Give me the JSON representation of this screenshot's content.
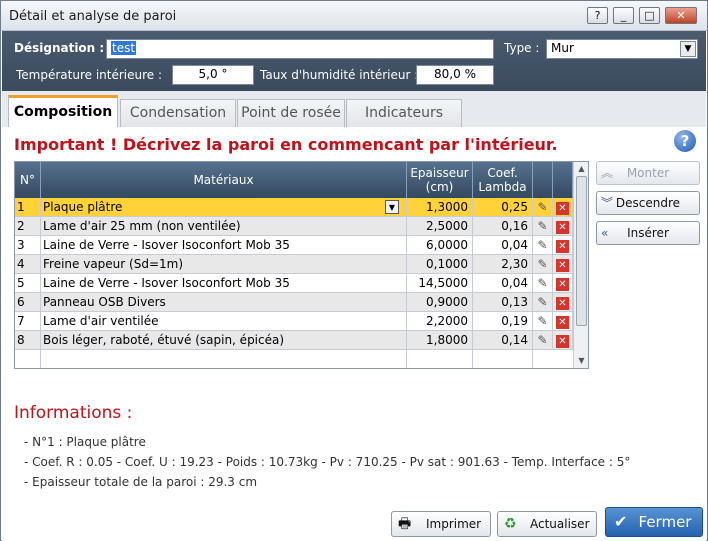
{
  "window": {
    "title": "Détail et analyse de paroi",
    "btn_help": "?",
    "btn_min": "_",
    "btn_max": "□",
    "btn_close": "✕"
  },
  "header": {
    "designation_label": "Désignation :",
    "designation_value": "test",
    "type_label": "Type :",
    "type_value": "Mur",
    "temp_label": "Température intérieure :",
    "temp_value": "5,0 °",
    "humid_label": "Taux d'humidité intérieur :",
    "humid_value": "80,0 %"
  },
  "tabs": [
    "Composition",
    "Condensation",
    "Point de rosée",
    "Indicateurs"
  ],
  "important": "Important ! Décrivez la paroi en commencant par l'intérieur.",
  "grid": {
    "headers": {
      "num": "N°",
      "materiaux": "Matériaux",
      "epaisseur": "Epaisseur (cm)",
      "lambda": "Coef. Lambda"
    },
    "rows": [
      {
        "n": "1",
        "mat": "Plaque plâtre",
        "ep": "1,3000",
        "lam": "0,25"
      },
      {
        "n": "2",
        "mat": "Lame d'air 25 mm (non ventilée)",
        "ep": "2,5000",
        "lam": "0,16"
      },
      {
        "n": "3",
        "mat": "Laine de Verre - Isover Isoconfort Mob 35",
        "ep": "6,0000",
        "lam": "0,04"
      },
      {
        "n": "4",
        "mat": "Freine vapeur (Sd=1m)",
        "ep": "0,1000",
        "lam": "2,30"
      },
      {
        "n": "5",
        "mat": "Laine de Verre - Isover Isoconfort Mob 35",
        "ep": "14,5000",
        "lam": "0,04"
      },
      {
        "n": "6",
        "mat": "Panneau OSB Divers",
        "ep": "0,9000",
        "lam": "0,13"
      },
      {
        "n": "7",
        "mat": "Lame d'air ventilée",
        "ep": "2,2000",
        "lam": "0,19"
      },
      {
        "n": "8",
        "mat": "Bois léger, raboté, étuvé (sapin, épicéa)",
        "ep": "1,8000",
        "lam": "0,14"
      }
    ]
  },
  "side_buttons": {
    "monter": "Monter",
    "descendre": "Descendre",
    "inserer": "Insérer"
  },
  "info": {
    "title": "Informations :",
    "line1": "- N°1 : Plaque plâtre",
    "line2": "- Coef. R : 0.05 - Coef. U : 19.23 - Poids : 10.73kg - Pv : 710.25 - Pv sat : 901.63 - Temp. Interface : 5°",
    "line3": "- Epaisseur totale de la paroi : 29.3 cm"
  },
  "buttons": {
    "imprimer": "Imprimer",
    "actualiser": "Actualiser",
    "fermer": "Fermer"
  }
}
